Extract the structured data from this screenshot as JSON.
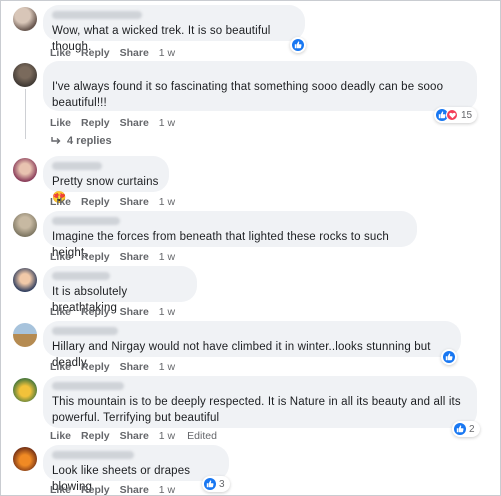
{
  "actions": {
    "like": "Like",
    "reply": "Reply",
    "share": "Share"
  },
  "comments": [
    {
      "text": "Wow, what a wicked trek. It is so beautiful though.",
      "time": "1 w",
      "reaction_count": "",
      "edited": ""
    },
    {
      "text": "I've always found it so fascinating that something sooo deadly can be sooo beautiful!!!",
      "time": "1 w",
      "reaction_count": "15",
      "edited": ""
    },
    {
      "text": "Pretty snow curtains😍",
      "time": "1 w",
      "reaction_count": "",
      "edited": ""
    },
    {
      "text": "Imagine the forces from beneath that lighted these rocks to such height.",
      "time": "1 w",
      "reaction_count": "",
      "edited": ""
    },
    {
      "text": "It is absolutely breathtaking",
      "time": "1 w",
      "reaction_count": "",
      "edited": ""
    },
    {
      "text": "Hillary and Nirgay would not have climbed it in winter..looks stunning but deadly",
      "time": "1 w",
      "reaction_count": "",
      "edited": ""
    },
    {
      "text": "This mountain is to be deeply respected. It is Nature in all its beauty and all its powerful. Terrifying but beautiful",
      "time": "1 w",
      "reaction_count": "2",
      "edited": "Edited"
    },
    {
      "text": "Look like sheets or drapes blowing",
      "time": "1 w",
      "reaction_count": "3",
      "edited": ""
    }
  ],
  "replies_label": "4 replies",
  "colors": {
    "like_blue": "#1877f2",
    "heart_red": "#f33e58",
    "bubble": "#f0f2f5",
    "meta": "#65676b"
  }
}
